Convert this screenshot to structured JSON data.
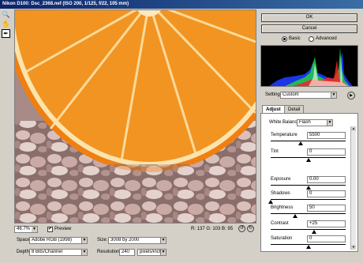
{
  "window": {
    "title": "Nikon D100:  Dsc_2368.nef  (ISO 200, 1/125, f/22, 105 mm)"
  },
  "tools": [
    {
      "name": "zoom-tool",
      "glyph": "🔍"
    },
    {
      "name": "hand-tool",
      "glyph": "✋"
    },
    {
      "name": "eyedropper-tool",
      "glyph": "✒"
    }
  ],
  "preview": {
    "zoom": "46.7%",
    "preview_label": "Preview",
    "preview_checked": true,
    "rgb_readout": "R: 137  G: 103  B:   95"
  },
  "workflow": {
    "space_label": "Space:",
    "space_value": "Adobe RGB (1998)",
    "size_label": "Size:",
    "size_value": "3008 by 2000",
    "depth_label": "Depth:",
    "depth_value": "8 Bits/Channel",
    "resolution_label": "Resolution:",
    "resolution_value": "240",
    "resolution_unit": "pixels/inch"
  },
  "buttons": {
    "ok": "OK",
    "cancel": "Cancel"
  },
  "mode": {
    "basic": "Basic",
    "advanced": "Advanced",
    "selected": "Basic"
  },
  "settings": {
    "label": "Settings:",
    "value": "Custom"
  },
  "tabs": [
    {
      "label": "Adjust",
      "active": true
    },
    {
      "label": "Detail",
      "active": false
    }
  ],
  "adjust": {
    "white_balance_label": "White Balance:",
    "white_balance_value": "Flash",
    "sliders": [
      {
        "key": "temperature",
        "label": "Temperature",
        "value": "5500",
        "level": 0.4
      },
      {
        "key": "tint",
        "label": "Tint",
        "value": "0",
        "level": 0.5
      },
      {
        "key": "exposure",
        "label": "Exposure",
        "value": "0.00",
        "level": 0.5
      },
      {
        "key": "shadows",
        "label": "Shadows",
        "value": "0",
        "level": 0.0
      },
      {
        "key": "brightness",
        "label": "Brightness",
        "value": "50",
        "level": 0.33
      },
      {
        "key": "contrast",
        "label": "Contrast",
        "value": "+25",
        "level": 0.58
      },
      {
        "key": "saturation",
        "label": "Saturation",
        "value": "0",
        "level": 0.5
      }
    ]
  },
  "colors": {
    "titlebar": "#0a246a",
    "orange": "#f29422",
    "panel": "#d4d0c8"
  }
}
